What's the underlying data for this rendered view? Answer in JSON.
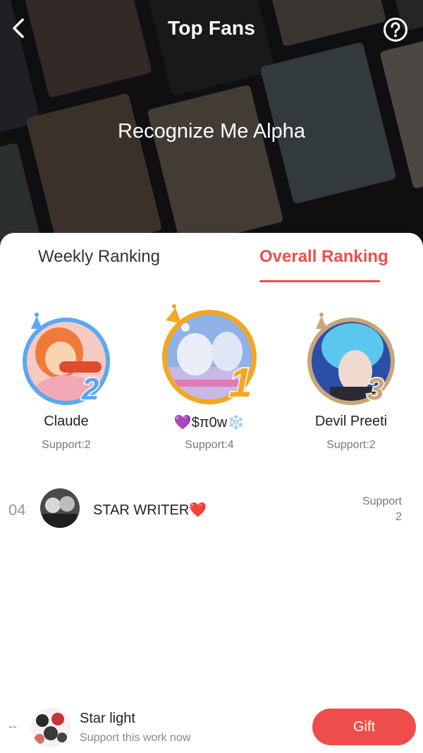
{
  "header": {
    "title": "Top Fans",
    "book_title": "Recognize Me Alpha",
    "back_icon": "chevron-left-icon",
    "help_icon": "question-circle-icon"
  },
  "tabs": [
    {
      "label": "Weekly Ranking",
      "active": false
    },
    {
      "label": "Overall Ranking",
      "active": true
    }
  ],
  "colors": {
    "accent": "#ee4e4b",
    "gold": "#f5a623",
    "silver": "#5aa8f0",
    "bronze": "#c8a67a"
  },
  "podium": [
    {
      "rank": "1",
      "name": "💜$π0w❄️",
      "support": "Support:4"
    },
    {
      "rank": "2",
      "name": "Claude",
      "support": "Support:2"
    },
    {
      "rank": "3",
      "name": "Devil Preeti",
      "support": "Support:2"
    }
  ],
  "ranking_list": [
    {
      "rank": "04",
      "name": "STAR WRITER❤️",
      "support_label": "Support",
      "support_value": "2"
    }
  ],
  "me": {
    "rank": "--",
    "name": "Star light",
    "subtitle": "Support this work now",
    "gift_label": "Gift"
  }
}
